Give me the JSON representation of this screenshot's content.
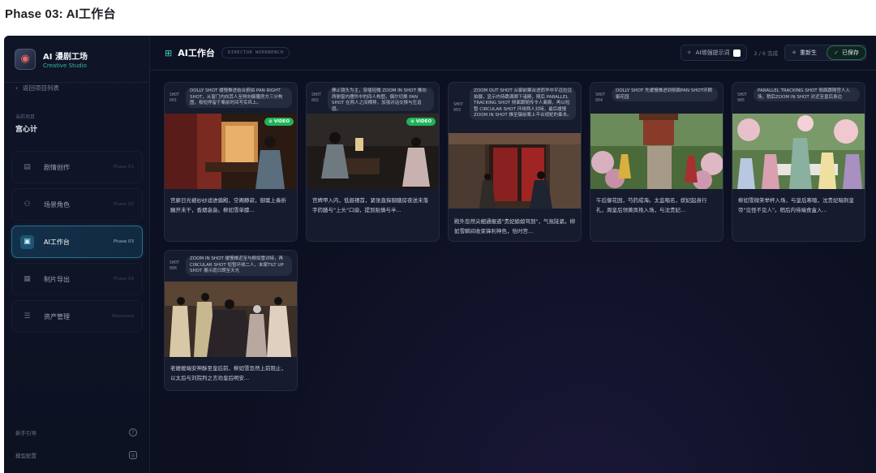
{
  "page_heading": "Phase 03: AI工作台",
  "sidebar": {
    "brand_title": "AI 漫剧工场",
    "brand_subtitle": "Creative Studio",
    "back_label": "返回项目列表",
    "project_label": "当前项目",
    "project_name": "宫心计",
    "items": [
      {
        "label": "剧情创作",
        "phase": "Phase 01",
        "icon": "document-icon"
      },
      {
        "label": "场景角色",
        "phase": "Phase 02",
        "icon": "users-icon"
      },
      {
        "label": "AI工作台",
        "phase": "Phase 03",
        "icon": "clapperboard-icon",
        "active": true
      },
      {
        "label": "制片导出",
        "phase": "Phase 04",
        "icon": "film-icon"
      },
      {
        "label": "资产管理",
        "phase": "Advanced",
        "icon": "list-icon"
      }
    ],
    "footer": [
      {
        "label": "新手引导",
        "icon": "help-icon"
      },
      {
        "label": "模型配置",
        "icon": "settings-icon"
      }
    ]
  },
  "topbar": {
    "title": "AI工作台",
    "badge": "DIRECTOR WORKBENCH",
    "enhance_label": "AI增强提示词",
    "progress": "2 / 6 完成",
    "regenerate_label": "重新生",
    "saved_label": "已保存"
  },
  "shots": [
    {
      "shot": "SHOT",
      "num": "001",
      "prompt": "DOLLY SHOT 缓慢推进结合俯拍 PAN RIGHT SHOT，从窗门内向其人至侧向御膳房方三分构图，极短停留于案前时间写实风上。",
      "video": "VIDEO",
      "desc": "宫廊日光被纱纱滤进偏殿，空阁静寂，御案上奏折臃开未干，香烟袅袅。柳如雪单膝..."
    },
    {
      "shot": "SHOT",
      "num": "002",
      "prompt": "静止镜头为主，穿插轻微 ZOOM IN SHOT 推向两侧窗内摆件中的四人构图，偶尔切换 PAN SHOT 在两人之间横移，加强对话交换与压迫感。",
      "video": "VIDEO",
      "desc": "宫婢甲入内，低眉禧首，紧张直探御膳房夜送未落字药膳与\"上头\"口谕，提到贴慎与半..."
    },
    {
      "shot": "SHOT",
      "num": "003",
      "prompt": "ZOOM OUT SHOT 从御前案台进而华中平远拉远拍摄，显示内侍跪满廊下诸殿，随后 PARALLEL TRACKING SHOT 侧面跟随传令人离殿，再以短暂 CIRCULAR SHOT 环绕两人对峙，最后缓慢 ZOOM IN SHOT 推至御前案上不合规矩的奏本。",
      "desc": "殿外忽然尖细通报道\"贵妃娘娘驾到\"，气氛陡紧。柳如雪瞬间收束锋利神色，恰时宫..."
    },
    {
      "shot": "SHOT",
      "num": "004",
      "prompt": "DOLLY SHOT 先缓慢推进到侧面PAN SHOT环顾御花园",
      "desc": "午后御花园，芍药成海。太监唱名，嫔妃起身行礼，周皇后领黄凤袍入场，与沈贵妃..."
    },
    {
      "shot": "SHOT",
      "num": "005",
      "prompt": "PARALLEL TRACKING SHOT 侧面跟随宫人入场，稍后ZOOM IN SHOT 对近至皇后身边",
      "desc": "柳如雪微笑举杯入场，与皇后寒暄，沈贵妃暗刺皇帝\"见怪不见人\"。稍后内侍端食盒入..."
    },
    {
      "shot": "SHOT",
      "num": "006",
      "prompt": "ZOOM IN SHOT 缓慢推近至与柳如雪对峙，再 CIRCULAR SHOT 短暂环绕二人，末尾TILT UP SHOT 展示庭日朗至天光",
      "desc": "老嬷嬷端安神酥至皇后前，柳如雪忽然上前阻止，以太后与刘院判之言劝皇后明安..."
    }
  ],
  "colors": {
    "accent": "#3fd0c0",
    "active_nav": "#2d6b8a",
    "video_badge": "#20b35a",
    "background": "#0c1020"
  }
}
